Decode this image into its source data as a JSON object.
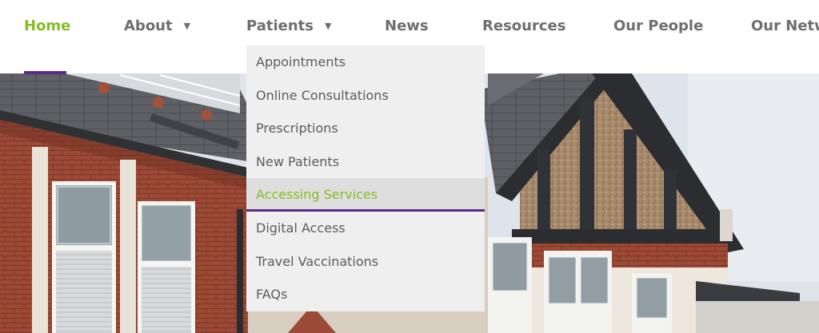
{
  "nav": {
    "items": [
      {
        "label": "Home"
      },
      {
        "label": "About"
      },
      {
        "label": "Patients"
      },
      {
        "label": "News"
      },
      {
        "label": "Resources"
      },
      {
        "label": "Our People"
      },
      {
        "label": "Our Netw"
      }
    ],
    "caret": "▼"
  },
  "dropdown": {
    "items": [
      {
        "label": "Appointments"
      },
      {
        "label": "Online Consultations"
      },
      {
        "label": "Prescriptions"
      },
      {
        "label": "New Patients"
      },
      {
        "label": "Accessing Services"
      },
      {
        "label": "Digital Access"
      },
      {
        "label": "Travel Vaccinations"
      },
      {
        "label": "FAQs"
      }
    ]
  },
  "colors": {
    "active": "#86bc25",
    "accent": "#5b2a86",
    "nav_text": "#6e6e6e",
    "dropdown_bg": "#efefef"
  }
}
